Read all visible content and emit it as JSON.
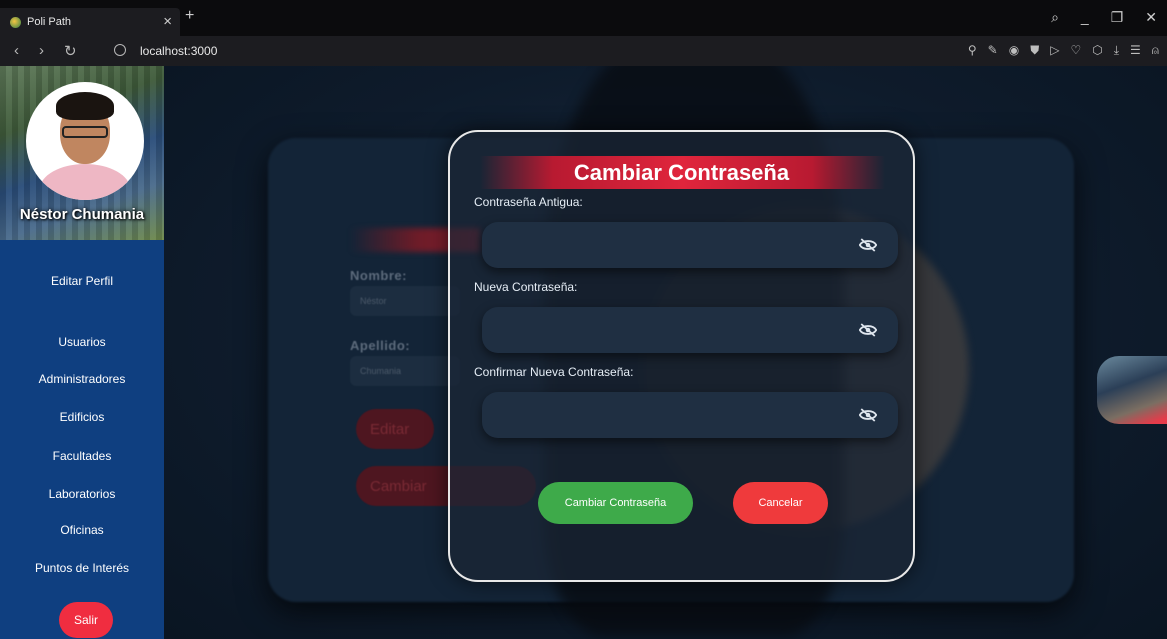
{
  "browser": {
    "tab_title": "Poli Path",
    "url": "localhost:3000"
  },
  "sidebar": {
    "user_name": "Néstor Chumania",
    "items": [
      {
        "label": "Editar Perfil"
      },
      {
        "label": "Usuarios"
      },
      {
        "label": "Administradores"
      },
      {
        "label": "Edificios"
      },
      {
        "label": "Facultades"
      },
      {
        "label": "Laboratorios"
      },
      {
        "label": "Oficinas"
      },
      {
        "label": "Puntos de Interés"
      }
    ],
    "logout_label": "Salir"
  },
  "background_form": {
    "nombre_label": "Nombre:",
    "nombre_value": "Néstor",
    "apellido_label": "Apellido:",
    "apellido_value": "Chumania",
    "edit_button": "Editar",
    "change_button": "Cambiar"
  },
  "modal": {
    "title": "Cambiar Contraseña",
    "old_password_label": "Contraseña Antigua:",
    "new_password_label": "Nueva Contraseña:",
    "confirm_password_label": "Confirmar Nueva Contraseña:",
    "submit_button": "Cambiar Contraseña",
    "cancel_button": "Cancelar"
  },
  "colors": {
    "sidebar": "#0f3f80",
    "accent_red": "#e0253c",
    "submit_green": "#3eaa4a",
    "cancel_red": "#ef3a3c"
  }
}
